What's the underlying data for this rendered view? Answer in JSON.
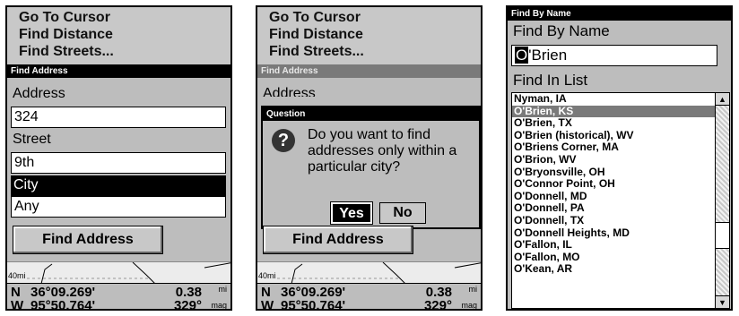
{
  "menu": [
    "Go To Cursor",
    "Find Distance",
    "Find Streets..."
  ],
  "find_address": {
    "title": "Find Address",
    "address_label": "Address",
    "address_value": "324",
    "street_label": "Street",
    "street_value": "9th",
    "city_label": "City",
    "city_value": "Any",
    "button_label": "Find Address"
  },
  "status": {
    "scale": "40mi",
    "lat_dir": "N",
    "lat": "36°09.269'",
    "distance": "0.38",
    "distance_unit": "mi",
    "lon_dir": "W",
    "lon": "95°50.764'",
    "bearing": "329°",
    "bearing_unit": "mag"
  },
  "question": {
    "title": "Question",
    "icon": "question-icon",
    "text": "Do you want to find addresses only within a particular city?",
    "yes": "Yes",
    "no": "No"
  },
  "find_by_name": {
    "title": "Find By Name",
    "heading": "Find By Name",
    "input_cursor_char": "O",
    "input_rest": "'Brien",
    "list_label": "Find In List",
    "selected_index": 1,
    "items": [
      "Nyman, IA",
      "O'Brien, KS",
      "O'Brien, TX",
      "O'Brien (historical), WV",
      "O'Briens Corner, MA",
      "O'Brion, WV",
      "O'Bryonsville, OH",
      "O'Connor Point, OH",
      "O'Donnell, MD",
      "O'Donnell, PA",
      "O'Donnell, TX",
      "O'Donnell Heights, MD",
      "O'Fallon, IL",
      "O'Fallon, MO",
      "O'Kean, AR"
    ]
  },
  "colors": {
    "screen_bg": "#bdbdbd",
    "selection": "#000000",
    "list_selection": "#7a7a7a"
  }
}
